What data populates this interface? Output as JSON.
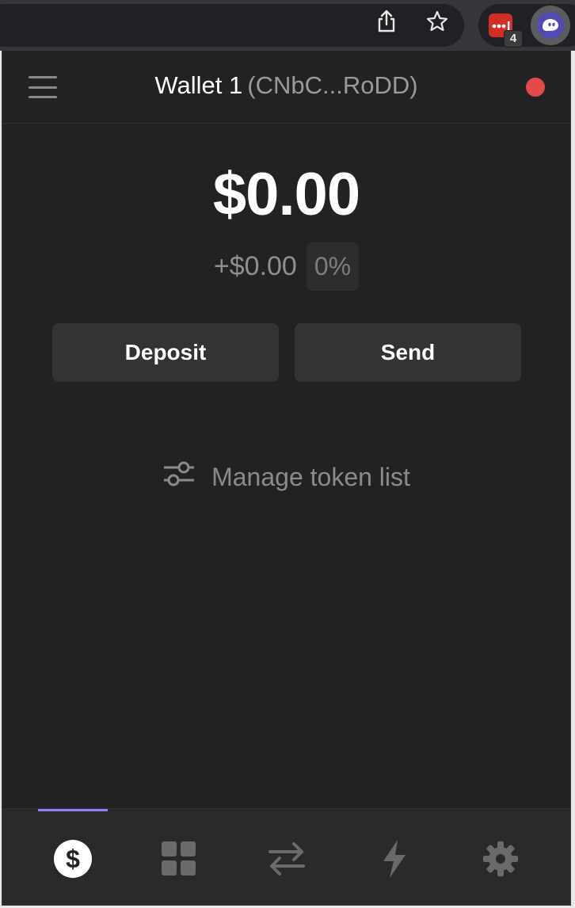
{
  "header": {
    "wallet_name": "Wallet 1",
    "wallet_address": "(CNbC...RoDD)"
  },
  "balance": {
    "total": "$0.00",
    "change_amount": "+$0.00",
    "change_percent": "0%"
  },
  "actions": {
    "deposit_label": "Deposit",
    "send_label": "Send"
  },
  "manage": {
    "label": "Manage token list"
  },
  "browser": {
    "extension_badge": "4"
  },
  "tabs": [
    {
      "name": "tokens",
      "icon": "dollar-icon",
      "active": true
    },
    {
      "name": "collectibles",
      "icon": "grid-icon",
      "active": false
    },
    {
      "name": "swap",
      "icon": "swap-arrows-icon",
      "active": false
    },
    {
      "name": "activity",
      "icon": "lightning-icon",
      "active": false
    },
    {
      "name": "settings",
      "icon": "gear-icon",
      "active": false
    }
  ],
  "colors": {
    "accent": "#8a81f8",
    "network_dot": "#e5484d",
    "background": "#222222"
  }
}
